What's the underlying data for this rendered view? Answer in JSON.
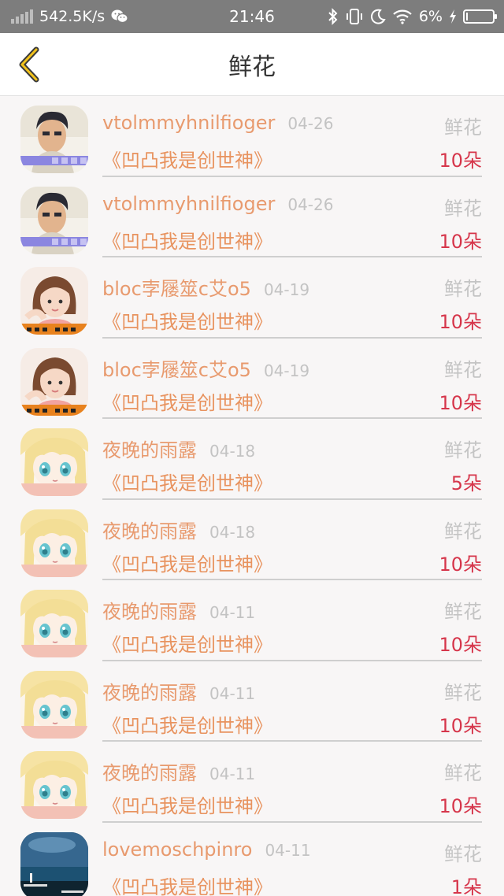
{
  "status_bar": {
    "speed": "542.5K/s",
    "time": "21:46",
    "battery": "6%",
    "battery_level": 0.06
  },
  "header": {
    "title": "鲜花"
  },
  "gifts": [
    {
      "user": "vtolmmyhnilfioger",
      "date": "04-26",
      "type": "鲜花",
      "book": "《凹凸我是创世神》",
      "count": "10朵",
      "avatar": "avatar-boy"
    },
    {
      "user": "vtolmmyhnilfioger",
      "date": "04-26",
      "type": "鲜花",
      "book": "《凹凸我是创世神》",
      "count": "10朵",
      "avatar": "avatar-boy"
    },
    {
      "user": "bloc孛屦筮c艾o5",
      "date": "04-19",
      "type": "鲜花",
      "book": "《凹凸我是创世神》",
      "count": "10朵",
      "avatar": "avatar-girl"
    },
    {
      "user": "bloc孛屦筮c艾o5",
      "date": "04-19",
      "type": "鲜花",
      "book": "《凹凸我是创世神》",
      "count": "10朵",
      "avatar": "avatar-girl"
    },
    {
      "user": "夜晚的雨露",
      "date": "04-18",
      "type": "鲜花",
      "book": "《凹凸我是创世神》",
      "count": "5朵",
      "avatar": "avatar-anime"
    },
    {
      "user": "夜晚的雨露",
      "date": "04-18",
      "type": "鲜花",
      "book": "《凹凸我是创世神》",
      "count": "10朵",
      "avatar": "avatar-anime"
    },
    {
      "user": "夜晚的雨露",
      "date": "04-11",
      "type": "鲜花",
      "book": "《凹凸我是创世神》",
      "count": "10朵",
      "avatar": "avatar-anime"
    },
    {
      "user": "夜晚的雨露",
      "date": "04-11",
      "type": "鲜花",
      "book": "《凹凸我是创世神》",
      "count": "10朵",
      "avatar": "avatar-anime"
    },
    {
      "user": "夜晚的雨露",
      "date": "04-11",
      "type": "鲜花",
      "book": "《凹凸我是创世神》",
      "count": "10朵",
      "avatar": "avatar-anime"
    },
    {
      "user": "lovemoschpinro",
      "date": "04-11",
      "type": "鲜花",
      "book": "《凹凸我是创世神》",
      "count": "1朵",
      "avatar": "avatar-sea"
    }
  ]
}
